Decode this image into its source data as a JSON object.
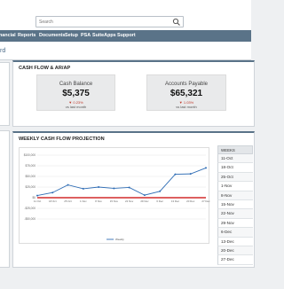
{
  "search": {
    "placeholder": "Search"
  },
  "nav": {
    "items": [
      {
        "label": "nancial"
      },
      {
        "label": "Reports"
      },
      {
        "label": "Documents"
      },
      {
        "label": "Setup"
      },
      {
        "label": "PSA"
      },
      {
        "label": "SuiteApps"
      },
      {
        "label": "Support"
      }
    ]
  },
  "page": {
    "title": "rd"
  },
  "cashflow": {
    "title": "CASH FLOW & AR/AP",
    "cash_balance": {
      "label": "Cash Balance",
      "value": "$5,375",
      "change": "▼ 0.23%",
      "sub": "vs last month"
    },
    "accounts_payable": {
      "label": "Accounts Payable",
      "value": "$65,321",
      "change": "▼ 1.03%",
      "sub": "vs last month"
    }
  },
  "projection": {
    "title": "WEEKLY CASH FLOW PROJECTION"
  },
  "weeks": {
    "header": "WEEKS",
    "rows": [
      "11-Oct",
      "18-Oct",
      "25-Oct",
      "1-Nov",
      "8-Nov",
      "15-Nov",
      "22-Nov",
      "29-Nov",
      "6-Dec",
      "13-Dec",
      "20-Dec",
      "27-Dec"
    ]
  },
  "colors": {
    "nav": "#5a7388",
    "line": "#2f6db5",
    "baseline": "#d22b2b"
  },
  "chart_data": {
    "type": "line",
    "categories": [
      "11 Oct",
      "18 Oct",
      "25 Oct",
      "1 Nov",
      "8 Nov",
      "15 Nov",
      "22 Nov",
      "29 Nov",
      "6 Dec",
      "13 Dec",
      "20 Dec",
      "27 Dec"
    ],
    "y_ticks": [
      "$100,000",
      "$75,000",
      "$50,000",
      "$25,000",
      "$0",
      "-$25,000",
      "-$50,000"
    ],
    "ylim": [
      -50000,
      100000
    ],
    "series": [
      {
        "name": "Weekly",
        "color": "#2f6db5",
        "values": [
          5000,
          12000,
          30000,
          21000,
          25000,
          22000,
          24000,
          6000,
          15000,
          55000,
          56000,
          70000
        ]
      }
    ],
    "baseline": 0,
    "legend": "bottom",
    "grid": true
  }
}
